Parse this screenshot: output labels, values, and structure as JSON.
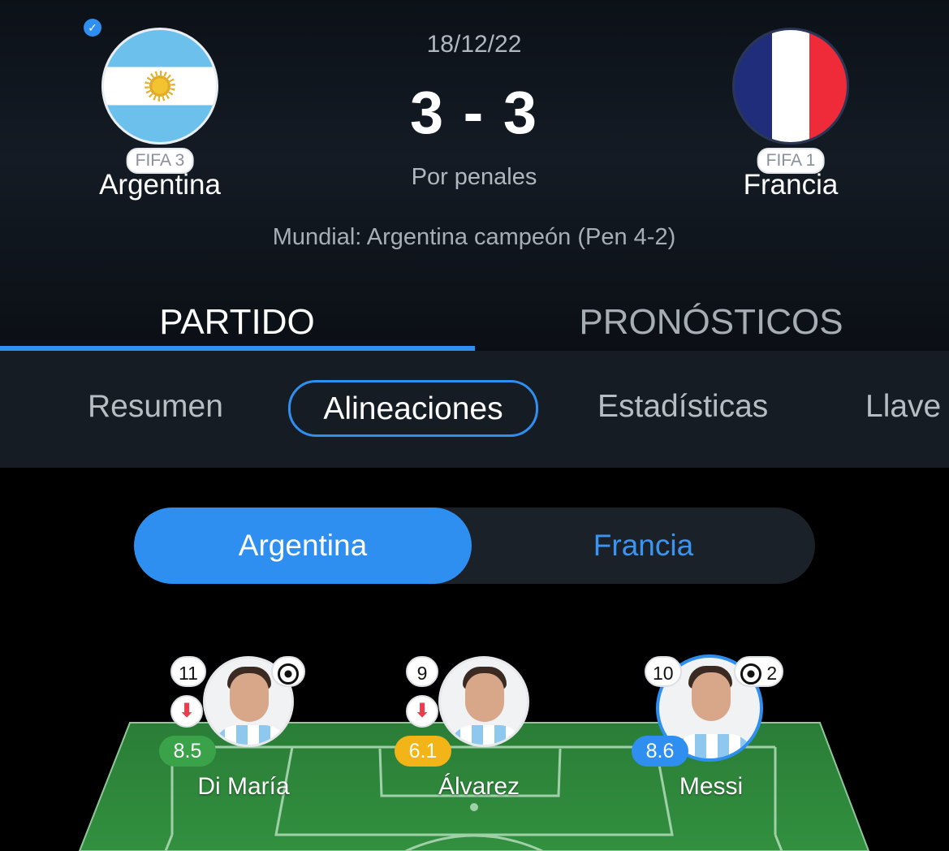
{
  "match": {
    "date": "18/12/22",
    "score": "3 - 3",
    "penalties_note": "Por penales",
    "result_note": "Mundial: Argentina campeón (Pen 4-2)"
  },
  "home": {
    "name": "Argentina",
    "rank": "FIFA 3",
    "verified_icon": "check-icon"
  },
  "away": {
    "name": "Francia",
    "rank": "FIFA 1"
  },
  "main_tabs": [
    {
      "label": "PARTIDO",
      "active": true
    },
    {
      "label": "PRONÓSTICOS",
      "active": false
    }
  ],
  "sub_tabs": [
    {
      "label": "Resumen"
    },
    {
      "label": "Alineaciones",
      "active": true
    },
    {
      "label": "Estadísticas"
    },
    {
      "label": "Llave"
    }
  ],
  "team_toggle": [
    {
      "label": "Argentina",
      "active": true
    },
    {
      "label": "Francia",
      "active": false
    }
  ],
  "players": [
    {
      "number": "11",
      "name": "Di María",
      "rating": "8.5",
      "rating_color": "#3aa34a",
      "goals": "",
      "substituted": true
    },
    {
      "number": "9",
      "name": "Álvarez",
      "rating": "6.1",
      "rating_color": "#f2b416",
      "goals": "",
      "substituted": true
    },
    {
      "number": "10",
      "name": "Messi",
      "rating": "8.6",
      "rating_color": "#2f8ff0",
      "goals": "2",
      "substituted": false
    }
  ],
  "colors": {
    "accent": "#2f8ff0",
    "pitch": "#2f8a3e"
  }
}
